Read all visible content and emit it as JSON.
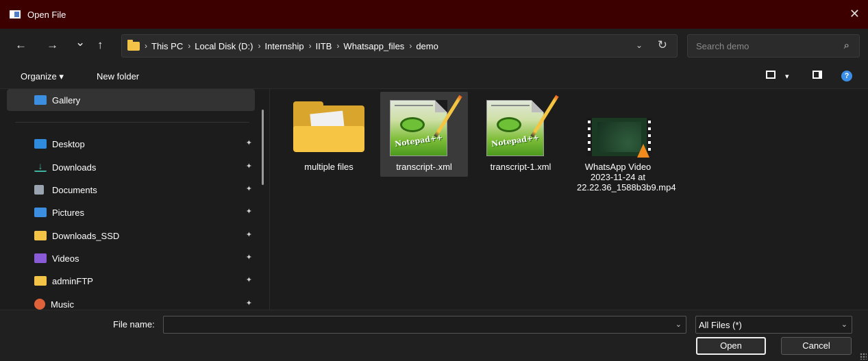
{
  "window": {
    "title": "Open File",
    "close_glyph": "✕"
  },
  "nav": {
    "back_glyph": "←",
    "forward_glyph": "→",
    "recent_glyph": "⌄",
    "up_glyph": "↑",
    "breadcrumb": [
      "This PC",
      "Local Disk (D:)",
      "Internship",
      "IITB",
      "Whatsapp_files",
      "demo"
    ],
    "separator": "›",
    "dropdown_glyph": "⌄",
    "refresh_glyph": "↻",
    "search_placeholder": "Search demo",
    "search_glyph": "⌕"
  },
  "toolbar": {
    "organize": "Organize ▾",
    "new_folder": "New folder",
    "view_dd": "▾",
    "help": "?"
  },
  "sidebar": {
    "items": [
      {
        "label": "Gallery",
        "icon": "gallery-icon",
        "color": "#3c8ee0",
        "pinned": false
      },
      {
        "label": "Desktop",
        "icon": "desktop-icon",
        "color": "#2f8bdc",
        "pinned": true
      },
      {
        "label": "Downloads",
        "icon": "download-icon",
        "color": "#3fb3a0",
        "pinned": true
      },
      {
        "label": "Documents",
        "icon": "documents-icon",
        "color": "#9aa4b0",
        "pinned": true
      },
      {
        "label": "Pictures",
        "icon": "pictures-icon",
        "color": "#3c8ee0",
        "pinned": true
      },
      {
        "label": "Downloads_SSD",
        "icon": "folder-icon",
        "color": "#f3c347",
        "pinned": true
      },
      {
        "label": "Videos",
        "icon": "videos-icon",
        "color": "#8a5bd6",
        "pinned": true
      },
      {
        "label": "adminFTP",
        "icon": "folder-icon",
        "color": "#f3c347",
        "pinned": true
      },
      {
        "label": "Music",
        "icon": "music-icon",
        "color": "#e0623a",
        "pinned": true
      }
    ],
    "pin_glyph": "📌"
  },
  "files": [
    {
      "name": "multiple files",
      "type": "folder",
      "selected": false
    },
    {
      "name": "transcript-.xml",
      "type": "notepadpp-xml",
      "selected": true
    },
    {
      "name": "transcript-1.xml",
      "type": "notepadpp-xml",
      "selected": false
    },
    {
      "name": "WhatsApp Video 2023-11-24 at 22.22.36_1588b3b9.mp4",
      "type": "video",
      "selected": false
    }
  ],
  "file_icon_word": "Notepad++",
  "bottom": {
    "file_name_label": "File name:",
    "file_name_value": "",
    "file_type": "All Files (*)",
    "dropdown_glyph": "⌄",
    "open_label": "Open",
    "cancel_label": "Cancel"
  }
}
